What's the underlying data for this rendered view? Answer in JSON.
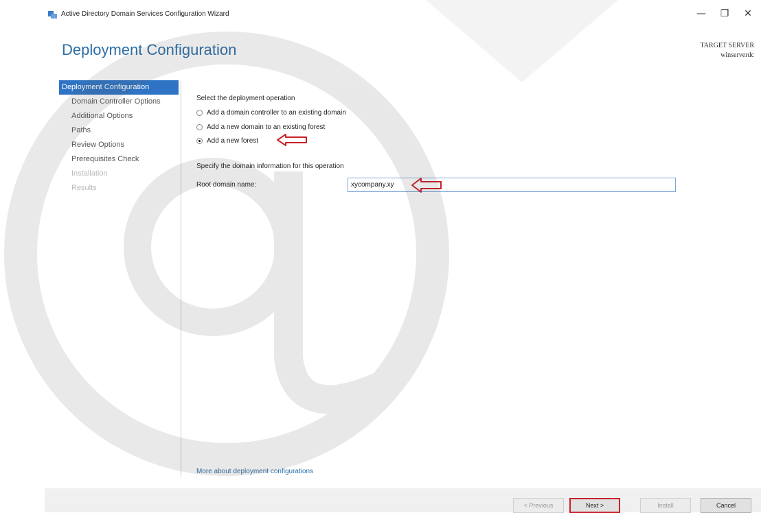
{
  "window": {
    "title": "Active Directory Domain Services Configuration Wizard",
    "controls": {
      "minimize": "—",
      "maximize": "❐",
      "close": "✕"
    }
  },
  "header": {
    "page_title": "Deployment Configuration",
    "target_server_label": "TARGET SERVER",
    "target_server_name": "winserverdc"
  },
  "steps": [
    {
      "label": "Deployment Configuration",
      "state": "active"
    },
    {
      "label": "Domain Controller Options",
      "state": "enabled"
    },
    {
      "label": "Additional Options",
      "state": "enabled"
    },
    {
      "label": "Paths",
      "state": "enabled"
    },
    {
      "label": "Review Options",
      "state": "enabled"
    },
    {
      "label": "Prerequisites Check",
      "state": "enabled"
    },
    {
      "label": "Installation",
      "state": "disabled"
    },
    {
      "label": "Results",
      "state": "disabled"
    }
  ],
  "main": {
    "operation_heading": "Select the deployment operation",
    "options": [
      {
        "label": "Add a domain controller to an existing domain",
        "checked": false
      },
      {
        "label": "Add a new domain to an existing forest",
        "checked": false
      },
      {
        "label": "Add a new forest",
        "checked": true
      }
    ],
    "domain_heading": "Specify the domain information for this operation",
    "root_domain_label": "Root domain name:",
    "root_domain_value": "xycompany.xy",
    "more_link": "More about deployment configurations"
  },
  "buttons": {
    "previous": "< Previous",
    "next": "Next >",
    "install": "Install",
    "cancel": "Cancel"
  },
  "colors": {
    "accent": "#2f74c4",
    "title_blue": "#2b6ea8",
    "annotation_red": "#c8202a"
  }
}
